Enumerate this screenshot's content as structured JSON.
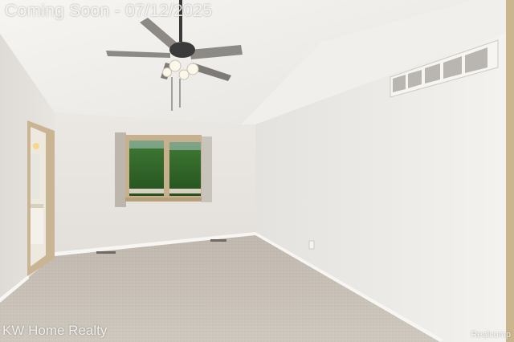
{
  "watermarks": {
    "status": "Coming Soon - 07/12/2025",
    "brokerage": "KW Home Realty",
    "source": "Realcomp"
  },
  "colors": {
    "ceiling": "#f3f2ef",
    "left_wall": "#e4e1dc",
    "back_wall": "#e9e6e1",
    "right_wall": "#eeece8",
    "carpet": "#c7bfb5",
    "baseboard": "#f7f6f3",
    "foliage": "#2f6a2a",
    "door_trim": "#c9b493"
  },
  "icons": [
    "ceiling-fan-icon",
    "hvac-vent-icon",
    "floor-vent-icon",
    "outlet-icon"
  ]
}
